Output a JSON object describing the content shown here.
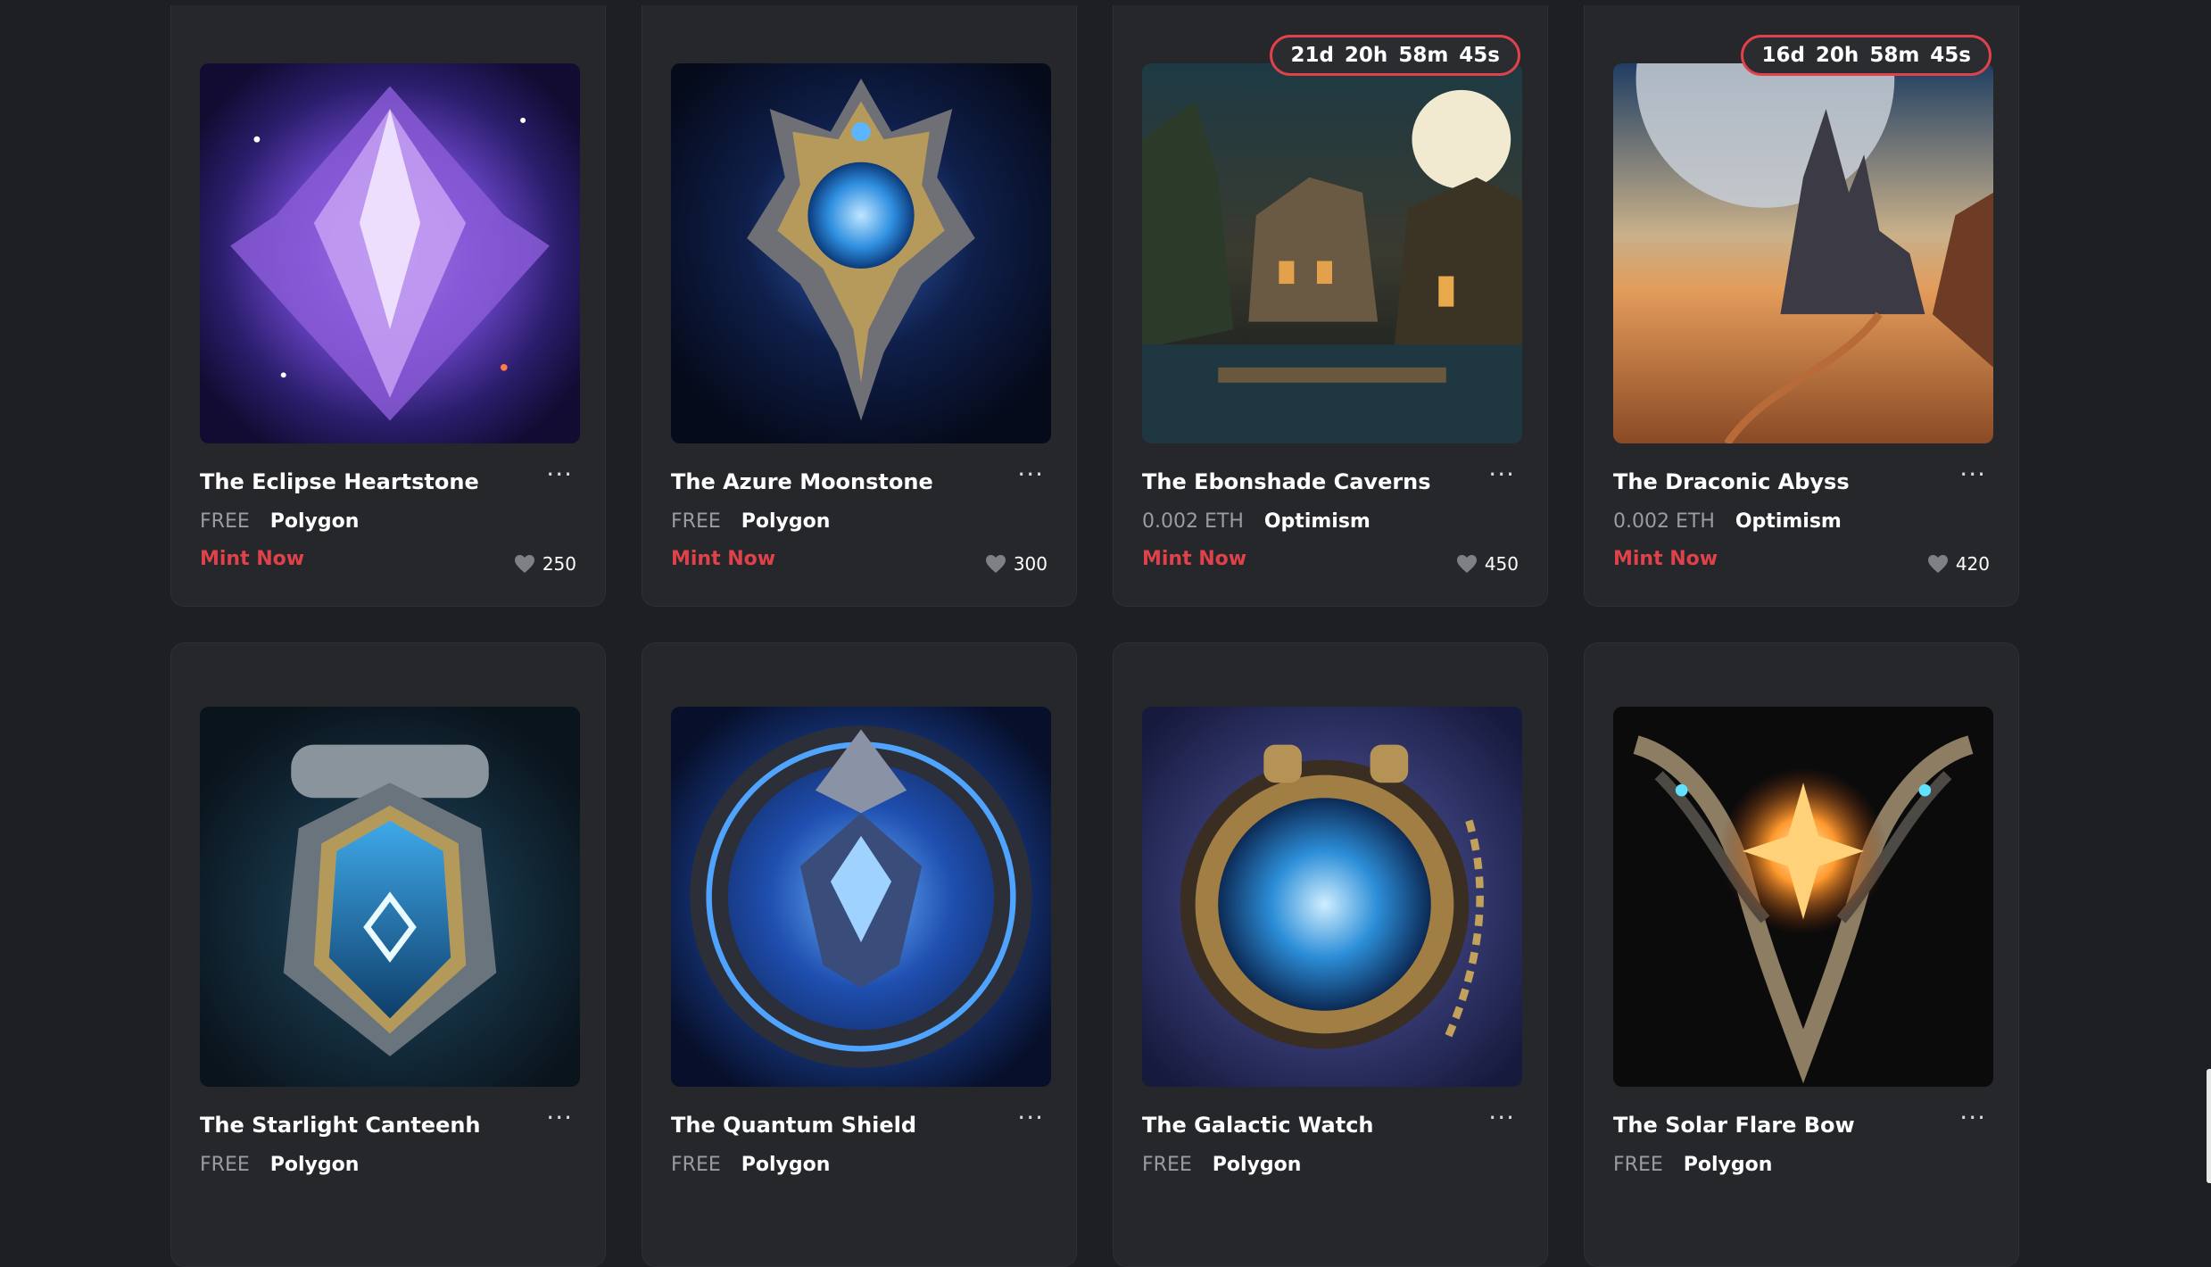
{
  "collections": [
    {
      "title": "The Eclipse Heartstone",
      "price": "FREE",
      "chain": "Polygon",
      "cta": "Mint Now",
      "likes": "250",
      "timer": null,
      "image": "purple-crystal-art"
    },
    {
      "title": "The Azure Moonstone",
      "price": "FREE",
      "chain": "Polygon",
      "cta": "Mint Now",
      "likes": "300",
      "timer": null,
      "image": "blue-orb-amulet-art"
    },
    {
      "title": "The Ebonshade Caverns",
      "price": "0.002 ETH",
      "chain": "Optimism",
      "cta": "Mint Now",
      "likes": "450",
      "timer": {
        "d": "21d",
        "h": "20h",
        "m": "58m",
        "s": "45s"
      },
      "image": "canyon-temple-art"
    },
    {
      "title": "The Draconic Abyss",
      "price": "0.002 ETH",
      "chain": "Optimism",
      "cta": "Mint Now",
      "likes": "420",
      "timer": {
        "d": "16d",
        "h": "20h",
        "m": "58m",
        "s": "45s"
      },
      "image": "desert-castle-art"
    },
    {
      "title": "The Starlight Canteenh",
      "price": "FREE",
      "chain": "Polygon",
      "image": "crystal-canteen-art"
    },
    {
      "title": "The Quantum Shield",
      "price": "FREE",
      "chain": "Polygon",
      "image": "blue-shield-art"
    },
    {
      "title": "The Galactic Watch",
      "price": "FREE",
      "chain": "Polygon",
      "image": "pocket-watch-art"
    },
    {
      "title": "The Solar Flare Bow",
      "price": "FREE",
      "chain": "Polygon",
      "image": "fire-bow-art"
    }
  ],
  "icons": {
    "more": "more-icon",
    "like": "heart-icon"
  },
  "colors": {
    "accent": "#e0424b",
    "background": "#1d1f22",
    "card": "#25272b"
  }
}
